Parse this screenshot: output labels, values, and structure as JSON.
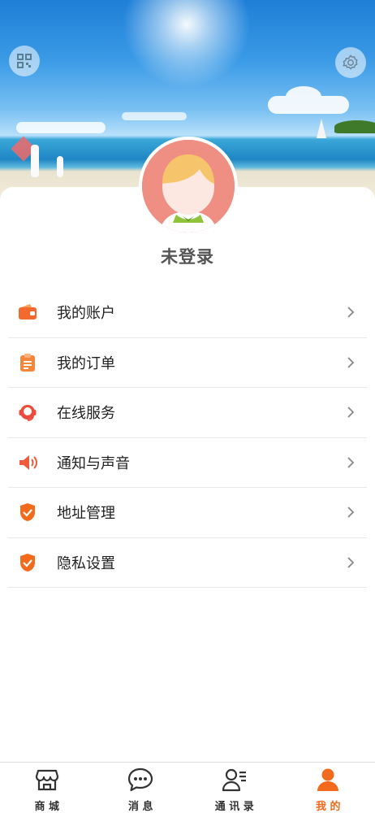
{
  "profile": {
    "username": "未登录"
  },
  "header": {
    "qr_icon": "qrcode-icon",
    "settings_icon": "gear-icon"
  },
  "menu": {
    "items": [
      {
        "label": "我的账户",
        "icon": "wallet-icon",
        "color": "#f26a2e"
      },
      {
        "label": "我的订单",
        "icon": "clipboard-icon",
        "color": "#f5873a"
      },
      {
        "label": "在线服务",
        "icon": "customer-service-icon",
        "color": "#ec4a3a"
      },
      {
        "label": "通知与声音",
        "icon": "speaker-icon",
        "color": "#ef5a3a"
      },
      {
        "label": "地址管理",
        "icon": "shield-check-icon",
        "color": "#f26a1b"
      },
      {
        "label": "隐私设置",
        "icon": "shield-check-icon",
        "color": "#f26a1b"
      }
    ]
  },
  "tabbar": {
    "tabs": [
      {
        "label": "商 城",
        "icon": "store-icon",
        "active": false
      },
      {
        "label": "消 息",
        "icon": "chat-bubble-icon",
        "active": false
      },
      {
        "label": "通 讯 录",
        "icon": "contacts-icon",
        "active": false
      },
      {
        "label": "我 的",
        "icon": "user-icon",
        "active": true
      }
    ],
    "active_color": "#f26a1b"
  }
}
